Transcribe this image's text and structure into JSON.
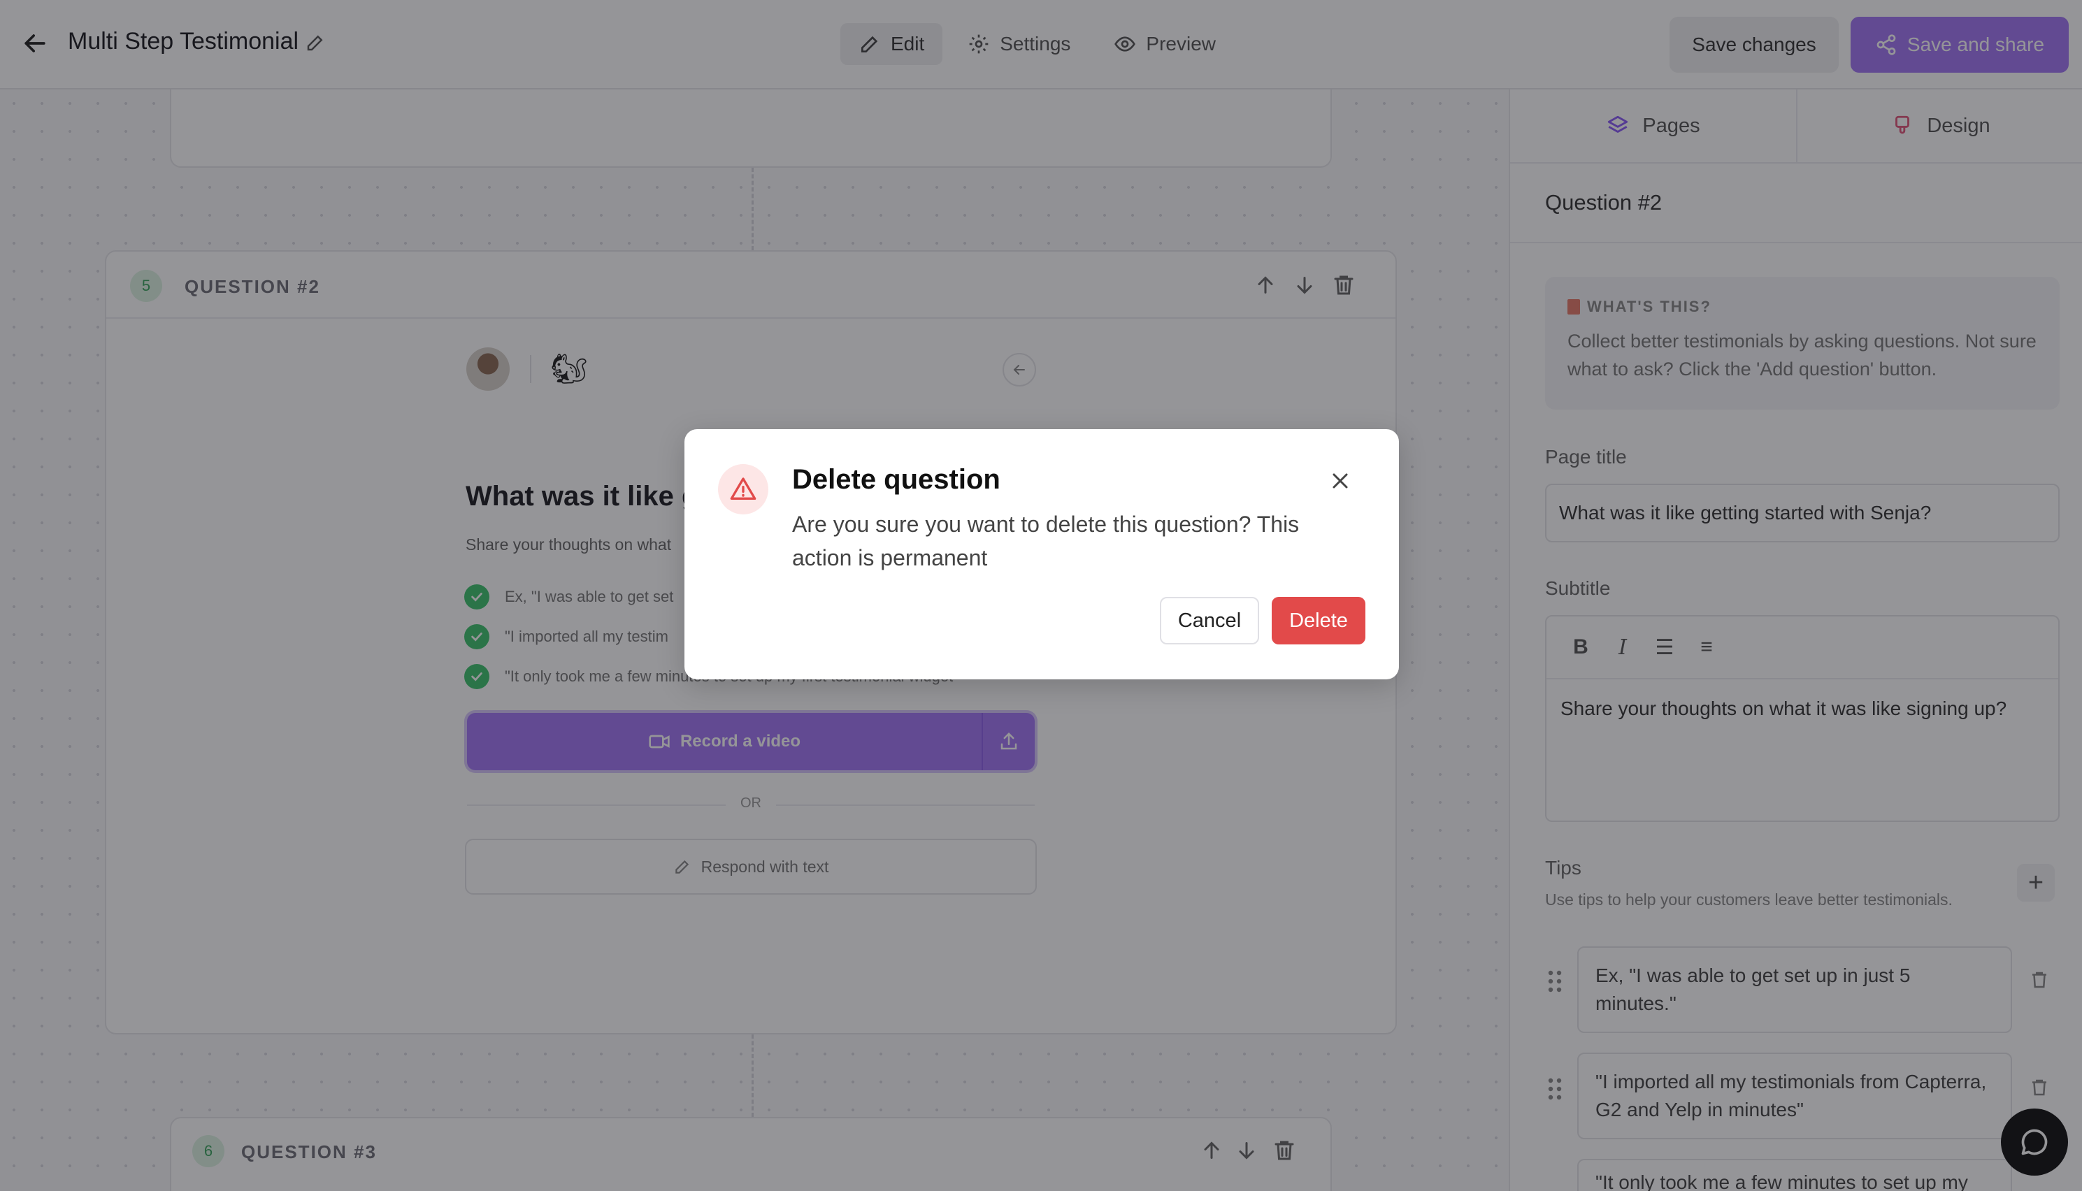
{
  "header": {
    "title": "Multi Step Testimonial",
    "tabs": [
      {
        "label": "Edit",
        "icon": "pencil-icon"
      },
      {
        "label": "Settings",
        "icon": "gear-icon"
      },
      {
        "label": "Preview",
        "icon": "eye-icon"
      }
    ],
    "save_changes": "Save changes",
    "save_share": "Save and share"
  },
  "colors": {
    "accent": "#a277f5",
    "danger": "#e24a4a",
    "success": "#3ec46d"
  },
  "canvas": {
    "question_card": {
      "number": "5",
      "label": "QUESTION #2",
      "preview_title": "What was it like g",
      "preview_subtitle": "Share your thoughts on what",
      "tips": [
        "Ex, \"I was able to get set",
        "\"I imported all my testim",
        "\"It only took me a few minutes to set up my first testimonial widget\""
      ],
      "record_label": "Record a video",
      "or_label": "OR",
      "text_label": "Respond with text"
    },
    "next_card": {
      "number": "6",
      "label": "QUESTION #3"
    }
  },
  "panel": {
    "tabs": [
      {
        "label": "Pages",
        "icon": "layers-icon"
      },
      {
        "label": "Design",
        "icon": "brush-icon"
      }
    ],
    "heading": "Question #2",
    "info_title": "WHAT'S THIS?",
    "info_text": "Collect better testimonials by asking questions. Not sure what to ask? Click the 'Add question' button.",
    "page_title_label": "Page title",
    "page_title_value": "What was it like getting started with Senja?",
    "subtitle_label": "Subtitle",
    "subtitle_value": "Share your thoughts on what it was like signing up?",
    "tips_label": "Tips",
    "tips_help": "Use tips to help your customers leave better testimonials.",
    "tips": [
      "Ex, \"I was able to get set up in just 5 minutes.\"",
      "\"I imported all my testimonials from Capterra, G2 and Yelp in minutes\"",
      "\"It only took me a few minutes to set up my"
    ]
  },
  "modal": {
    "title": "Delete question",
    "body": "Are you sure you want to delete this question? This action is permanent",
    "cancel": "Cancel",
    "delete": "Delete"
  }
}
